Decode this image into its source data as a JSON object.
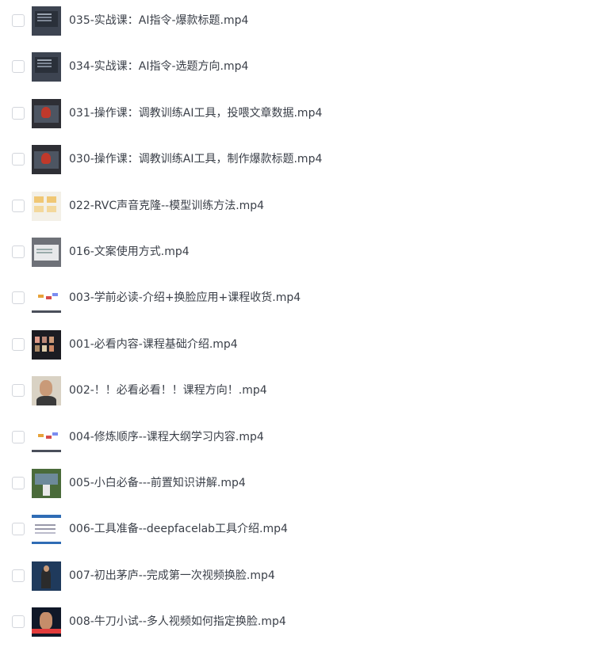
{
  "files": [
    {
      "name": "035-实战课：AI指令-爆款标题.mp4",
      "thumb": "t-dark"
    },
    {
      "name": "034-实战课：AI指令-选题方向.mp4",
      "thumb": "t-dark"
    },
    {
      "name": "031-操作课：调教训练AI工具，投喂文章数据.mp4",
      "thumb": "t-screen"
    },
    {
      "name": "030-操作课：调教训练AI工具，制作爆款标题.mp4",
      "thumb": "t-screen"
    },
    {
      "name": "022-RVC声音克隆--模型训练方法.mp4",
      "thumb": "t-light"
    },
    {
      "name": "016-文案使用方式.mp4",
      "thumb": "t-doc"
    },
    {
      "name": "003-学前必读-介绍+换脸应用+课程收货.mp4",
      "thumb": "t-slide"
    },
    {
      "name": "001-必看内容-课程基础介绍.mp4",
      "thumb": "t-grid"
    },
    {
      "name": "002-！！必看必看！！课程方向！.mp4",
      "thumb": "t-face"
    },
    {
      "name": "004-修炼顺序--课程大纲学习内容.mp4",
      "thumb": "t-slide"
    },
    {
      "name": "005-小白必备---前置知识讲解.mp4",
      "thumb": "t-class"
    },
    {
      "name": "006-工具准备--deepfacelab工具介绍.mp4",
      "thumb": "t-web"
    },
    {
      "name": "007-初出茅庐--完成第一次视频换脸.mp4",
      "thumb": "t-stage"
    },
    {
      "name": "008-牛刀小试--多人视频如何指定换脸.mp4",
      "thumb": "t-news"
    }
  ]
}
